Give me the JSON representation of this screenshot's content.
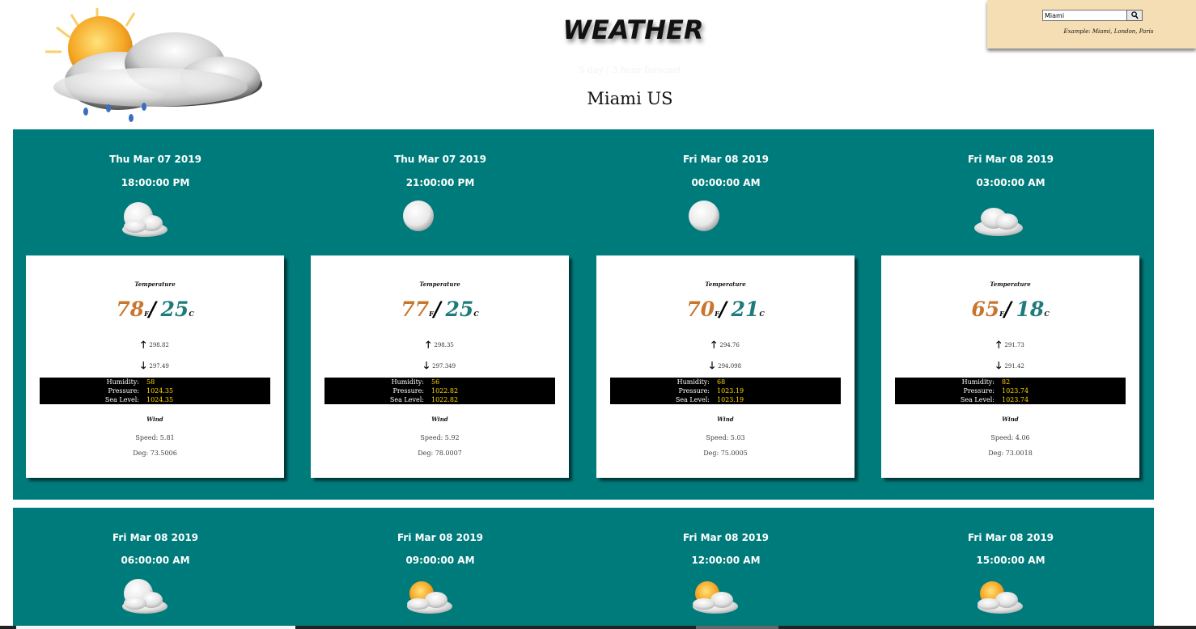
{
  "header": {
    "title": "WEATHER",
    "subtitle": "5 day | 3 hour forecast",
    "city": "Miami US",
    "logo_icon": "sun-behind-rain-cloud-icon"
  },
  "search": {
    "value": "Miami",
    "button_icon": "search-icon",
    "hint": "Example: Miami, London, Paris"
  },
  "colors": {
    "panel_bg": "#007b7b",
    "search_panel_bg": "#f5deb3",
    "fahrenheit": "#c8762e",
    "celsius": "#1e7b7b",
    "stat_values": "#ffd700"
  },
  "labels": {
    "temperature": "Temperature",
    "wind": "Wind",
    "humidity": "Humidity:",
    "pressure": "Pressure:",
    "sea_level": "Sea Level:",
    "unit_f": "F",
    "unit_c": "C",
    "separator": "/",
    "up_arrow": "🡑",
    "down_arrow": "🡓"
  },
  "rows": [
    [
      {
        "date": "Thu Mar 07 2019",
        "time": "18:00:00 PM",
        "icon": "moon-cloud-icon",
        "temp_f": "78",
        "temp_c": "25",
        "temp_max": "298.82",
        "temp_min": "297.49",
        "humidity": "58",
        "pressure": "1024.35",
        "sea_level": "1024.35",
        "wind_speed": "Speed: 5.81",
        "wind_deg": "Deg: 73.5006"
      },
      {
        "date": "Thu Mar 07 2019",
        "time": "21:00:00 PM",
        "icon": "moon-icon",
        "temp_f": "77",
        "temp_c": "25",
        "temp_max": "298.35",
        "temp_min": "297.349",
        "humidity": "56",
        "pressure": "1022.82",
        "sea_level": "1022.82",
        "wind_speed": "Speed: 5.92",
        "wind_deg": "Deg: 78.0007"
      },
      {
        "date": "Fri Mar 08 2019",
        "time": "00:00:00 AM",
        "icon": "moon-icon",
        "temp_f": "70",
        "temp_c": "21",
        "temp_max": "294.76",
        "temp_min": "294.098",
        "humidity": "68",
        "pressure": "1023.19",
        "sea_level": "1023.19",
        "wind_speed": "Speed: 5.03",
        "wind_deg": "Deg: 75.0005"
      },
      {
        "date": "Fri Mar 08 2019",
        "time": "03:00:00 AM",
        "icon": "cloud-icon",
        "temp_f": "65",
        "temp_c": "18",
        "temp_max": "291.73",
        "temp_min": "291.42",
        "humidity": "82",
        "pressure": "1023.74",
        "sea_level": "1023.74",
        "wind_speed": "Speed: 4.06",
        "wind_deg": "Deg: 73.0018"
      }
    ],
    [
      {
        "date": "Fri Mar 08 2019",
        "time": "06:00:00 AM",
        "icon": "moon-cloud-icon"
      },
      {
        "date": "Fri Mar 08 2019",
        "time": "09:00:00 AM",
        "icon": "sun-cloud-icon"
      },
      {
        "date": "Fri Mar 08 2019",
        "time": "12:00:00 AM",
        "icon": "sun-cloud-icon"
      },
      {
        "date": "Fri Mar 08 2019",
        "time": "15:00:00 AM",
        "icon": "sun-cloud-icon"
      }
    ]
  ]
}
